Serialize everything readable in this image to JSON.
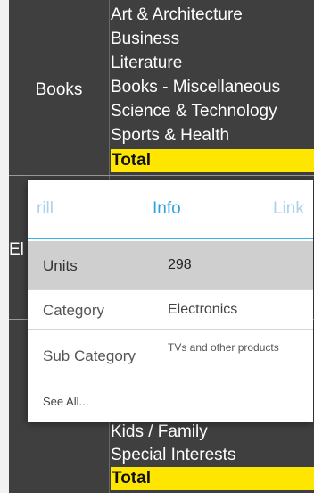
{
  "pivot": {
    "groups": [
      {
        "label": "Books",
        "subcategories": [
          "Art & Architecture",
          "Business",
          "Literature",
          "Books - Miscellaneous",
          "Science & Technology",
          "Sports & Health"
        ],
        "total_label": "Total"
      },
      {
        "label_visible": "El",
        "subcategories": [],
        "total_label": ""
      },
      {
        "label": "",
        "subcategories": [
          "Kids / Family",
          "Special Interests"
        ],
        "total_label": "Total"
      }
    ],
    "colors": {
      "background": "#3f3f3f",
      "total_highlight": "#ffe600",
      "text": "#ffffff"
    }
  },
  "popup": {
    "tabs": [
      "rill",
      "Info",
      "Link"
    ],
    "active_tab": "Info",
    "rows": [
      {
        "key": "Units",
        "value": "298",
        "selected": true
      },
      {
        "key": "Category",
        "value": "Electronics",
        "selected": false
      },
      {
        "key": "Sub Category",
        "value": "TVs and other products",
        "selected": false
      }
    ],
    "see_all": "See All...",
    "colors": {
      "accent": "#33b5e5",
      "selected_row": "#cfcfcf"
    }
  }
}
